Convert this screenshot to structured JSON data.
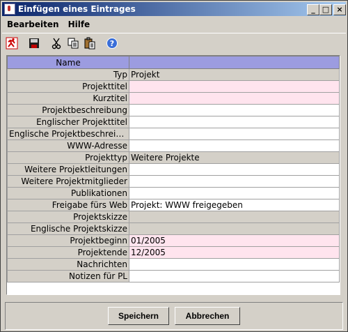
{
  "window": {
    "title": "Einfügen eines Eintrages"
  },
  "menubar": {
    "items": [
      {
        "label": "Bearbeiten"
      },
      {
        "label": "Hilfe"
      }
    ]
  },
  "toolbar": {
    "icons": [
      "exit-icon",
      "save-icon",
      "cut-icon",
      "copy-icon",
      "paste-icon",
      "help-icon"
    ]
  },
  "table": {
    "columns": [
      "Name",
      ""
    ],
    "rows": [
      {
        "label": "Typ",
        "value": "Projekt",
        "style": "gray"
      },
      {
        "label": "Projekttitel",
        "value": "",
        "style": "pink"
      },
      {
        "label": "Kurztitel",
        "value": "",
        "style": "pink"
      },
      {
        "label": "Projektbeschreibung",
        "value": "",
        "style": "white"
      },
      {
        "label": "Englischer Projekttitel",
        "value": "",
        "style": "white"
      },
      {
        "label": "Englische Projektbeschreibu...",
        "value": "",
        "style": "white"
      },
      {
        "label": "WWW-Adresse",
        "value": "",
        "style": "white"
      },
      {
        "label": "Projekttyp",
        "value": "Weitere Projekte",
        "style": "gray"
      },
      {
        "label": "Weitere Projektleitungen",
        "value": "",
        "style": "white"
      },
      {
        "label": "Weitere Projektmitglieder",
        "value": "",
        "style": "white"
      },
      {
        "label": "Publikationen",
        "value": "",
        "style": "white"
      },
      {
        "label": "Freigabe fürs Web",
        "value": "Projekt: WWW freigegeben",
        "style": "white"
      },
      {
        "label": "Projektskizze",
        "value": "",
        "style": "gray"
      },
      {
        "label": "Englische Projektskizze",
        "value": "",
        "style": "gray"
      },
      {
        "label": "Projektbeginn",
        "value": "01/2005",
        "style": "pink"
      },
      {
        "label": "Projektende",
        "value": "12/2005",
        "style": "pink"
      },
      {
        "label": "Nachrichten",
        "value": "",
        "style": "white"
      },
      {
        "label": "Notizen für PL",
        "value": "",
        "style": "white"
      }
    ]
  },
  "buttons": {
    "save": "Speichern",
    "cancel": "Abbrechen"
  },
  "colors": {
    "title_start": "#0a246a",
    "title_end": "#a6caf0",
    "header": "#9c9ce0",
    "required": "#ffe4ee",
    "readonly": "#d4d0c8"
  }
}
